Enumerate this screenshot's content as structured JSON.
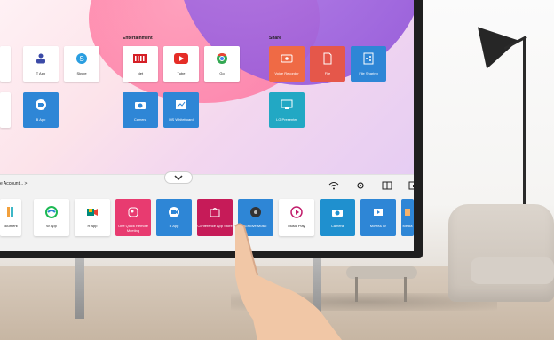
{
  "colors": {
    "orange": "#ef6a45",
    "red": "#e5574a",
    "blue": "#2e86d6",
    "teal": "#22a8c4",
    "pink": "#e83b70",
    "darkred": "#cc1d5f"
  },
  "home": {
    "sections": [
      {
        "title": "Entertainment"
      },
      {
        "title": "Share"
      }
    ],
    "apps_left": [
      {
        "label": "T App",
        "icon": "team-icon"
      },
      {
        "label": "Skype",
        "icon": "skype-icon"
      },
      {
        "label": "B App",
        "icon": "video-camera-icon"
      }
    ],
    "apps_entertainment": [
      {
        "label": "Net",
        "icon": "netflix-icon"
      },
      {
        "label": "Tube",
        "icon": "youtube-icon"
      },
      {
        "label": "Go",
        "icon": "chrome-icon"
      },
      {
        "label": "Camera",
        "icon": "camera-icon"
      },
      {
        "label": "MS Whiteboard",
        "icon": "whiteboard-icon"
      }
    ],
    "apps_share": [
      {
        "label": "Voice Recorder",
        "icon": "voice-recorder-icon"
      },
      {
        "label": "File",
        "icon": "file-icon"
      },
      {
        "label": "File Sharing",
        "icon": "file-sharing-icon"
      },
      {
        "label": "LG Presenter",
        "icon": "presenter-icon"
      }
    ]
  },
  "taskbar": {
    "account": "e Account... >",
    "system_icons": [
      "wifi-icon",
      "settings-icon",
      "window-icon",
      "screen-share-icon"
    ],
    "dock": [
      {
        "label": "ocument",
        "icon": "document-icon"
      },
      {
        "label": "W App",
        "icon": "webex-icon"
      },
      {
        "label": "R App",
        "icon": "meet-icon"
      },
      {
        "label": "One Quick Remote Meeting",
        "icon": "remote-meeting-icon"
      },
      {
        "label": "B App",
        "icon": "video-camera-icon"
      },
      {
        "label": "Conference App Store",
        "icon": "store-icon"
      },
      {
        "label": "Groove Music",
        "icon": "groove-icon"
      },
      {
        "label": "Music Play",
        "icon": "music-play-icon"
      },
      {
        "label": "Camera",
        "icon": "camera-icon"
      },
      {
        "label": "Movie&TV",
        "icon": "movie-icon"
      },
      {
        "label": "Media",
        "icon": "media-icon"
      }
    ]
  }
}
